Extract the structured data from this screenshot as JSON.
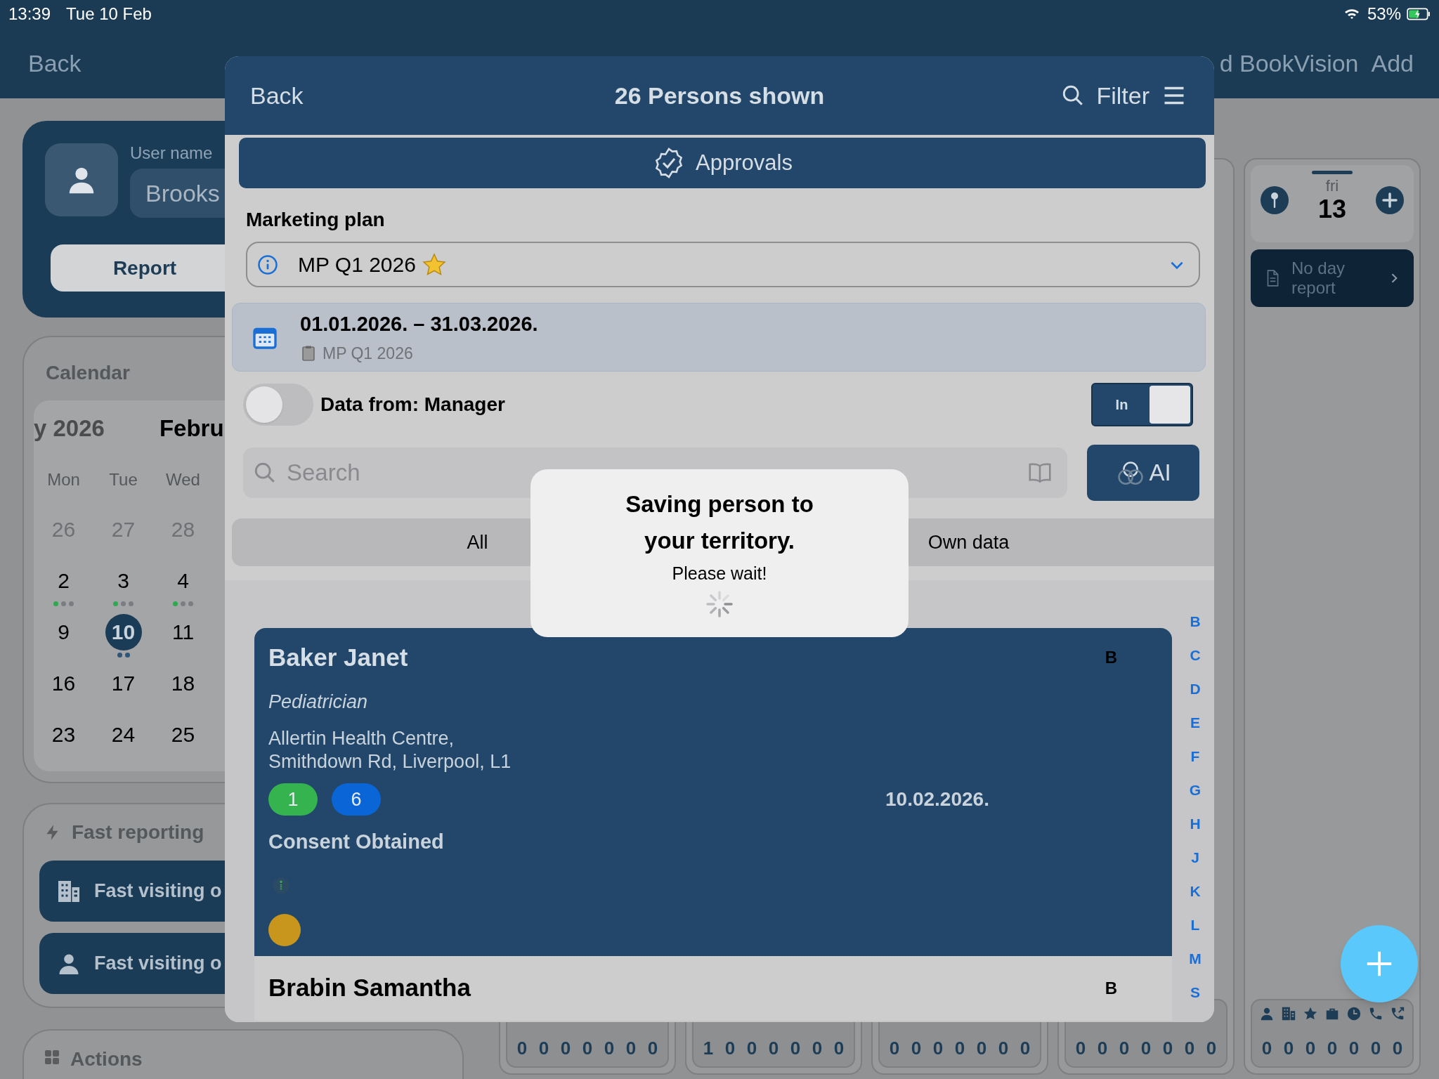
{
  "status_bar": {
    "time": "13:39",
    "date": "Tue 10 Feb",
    "battery": "53%"
  },
  "nav": {
    "back": "Back",
    "title": "d BookVision",
    "add": "Add"
  },
  "user": {
    "label": "User name",
    "name": "Brooks",
    "report": "Report"
  },
  "calendar": {
    "title": "Calendar",
    "month_prev": "y 2026",
    "month_current": "Febru",
    "weekdays": [
      "Mon",
      "Tue",
      "Wed"
    ],
    "weeks": [
      [
        {
          "day": "26",
          "outside": true,
          "selected": false
        },
        {
          "day": "27",
          "outside": true,
          "selected": false
        },
        {
          "day": "28",
          "outside": true,
          "selected": false
        }
      ],
      [
        {
          "day": "2",
          "outside": false,
          "selected": false,
          "dots": [
            {
              "color": "#2fa84f"
            },
            {
              "color": "#7b7d80"
            },
            {
              "color": "#7b7d80"
            }
          ]
        },
        {
          "day": "3",
          "outside": false,
          "selected": false,
          "dots": [
            {
              "color": "#2fa84f"
            },
            {
              "color": "#7b7d80"
            },
            {
              "color": "#7b7d80"
            }
          ]
        },
        {
          "day": "4",
          "outside": false,
          "selected": false,
          "dots": [
            {
              "color": "#2fa84f"
            },
            {
              "color": "#7b7d80"
            },
            {
              "color": "#7b7d80"
            }
          ]
        }
      ],
      [
        {
          "day": "9",
          "outside": false,
          "selected": false
        },
        {
          "day": "10",
          "outside": false,
          "selected": true,
          "dots": [
            {
              "color": "#2f5677"
            },
            {
              "color": "#2f5677"
            }
          ]
        },
        {
          "day": "11",
          "outside": false,
          "selected": false
        }
      ],
      [
        {
          "day": "16",
          "outside": false,
          "selected": false
        },
        {
          "day": "17",
          "outside": false,
          "selected": false
        },
        {
          "day": "18",
          "outside": false,
          "selected": false
        }
      ],
      [
        {
          "day": "23",
          "outside": false,
          "selected": false
        },
        {
          "day": "24",
          "outside": false,
          "selected": false
        },
        {
          "day": "25",
          "outside": false,
          "selected": false
        }
      ]
    ]
  },
  "fast_reporting": {
    "title": "Fast reporting",
    "buttons": [
      {
        "kind": "building",
        "label": "Fast visiting o"
      },
      {
        "kind": "person",
        "label": "Fast visiting o"
      }
    ]
  },
  "actions": {
    "title": "Actions"
  },
  "day_columns": [
    {
      "counters": [
        "0",
        "0",
        "0",
        "0",
        "0",
        "0",
        "0"
      ]
    },
    {
      "counters": [
        "1",
        "0",
        "0",
        "0",
        "0",
        "0",
        "0"
      ]
    },
    {
      "counters": [
        "0",
        "0",
        "0",
        "0",
        "0",
        "0",
        "0"
      ]
    },
    {
      "counters": [
        "0",
        "0",
        "0",
        "0",
        "0",
        "0",
        "0"
      ]
    }
  ],
  "day_column": {
    "weekday": "fri",
    "day": "13",
    "report": "No day report",
    "counters": [
      "0",
      "0",
      "0",
      "0",
      "0",
      "0",
      "0"
    ]
  },
  "modal": {
    "back": "Back",
    "title": "26 Persons shown",
    "filter": "Filter",
    "approvals": "Approvals",
    "plan_label": "Marketing plan",
    "plan_value": "MP Q1 2026",
    "period": {
      "dates": "01.01.2026. – 31.03.2026.",
      "plan": "MP Q1 2026"
    },
    "manager_toggle": {
      "label": "Data from: Manager",
      "on": false
    },
    "in_toggle": {
      "label": "In",
      "on": true
    },
    "search": {
      "placeholder": "Search"
    },
    "ai": "AI",
    "segments": [
      {
        "label": "All",
        "selected": false
      },
      {
        "label": "Own data",
        "selected": false
      }
    ],
    "persons": [
      {
        "name": "Baker Janet",
        "letter": "B",
        "selected": true,
        "specialty": "Pediatrician",
        "address": [
          "Allertin Health Centre,",
          "Smithdown Rd, Liverpool, L1"
        ],
        "counts": [
          {
            "value": "1",
            "color": "#34b34f"
          },
          {
            "value": "6",
            "color": "#0a66d6"
          }
        ],
        "date": "10.02.2026.",
        "consent": "Consent Obtained",
        "status_dot": {
          "color": "#c8961c"
        }
      },
      {
        "name": "Brabin Samantha",
        "letter": "B",
        "selected": false
      }
    ],
    "index": [
      "B",
      "C",
      "D",
      "E",
      "F",
      "G",
      "H",
      "J",
      "K",
      "L",
      "M",
      "S"
    ]
  },
  "dialog": {
    "title": "Saving person to your territory.",
    "message": "Please wait!"
  }
}
